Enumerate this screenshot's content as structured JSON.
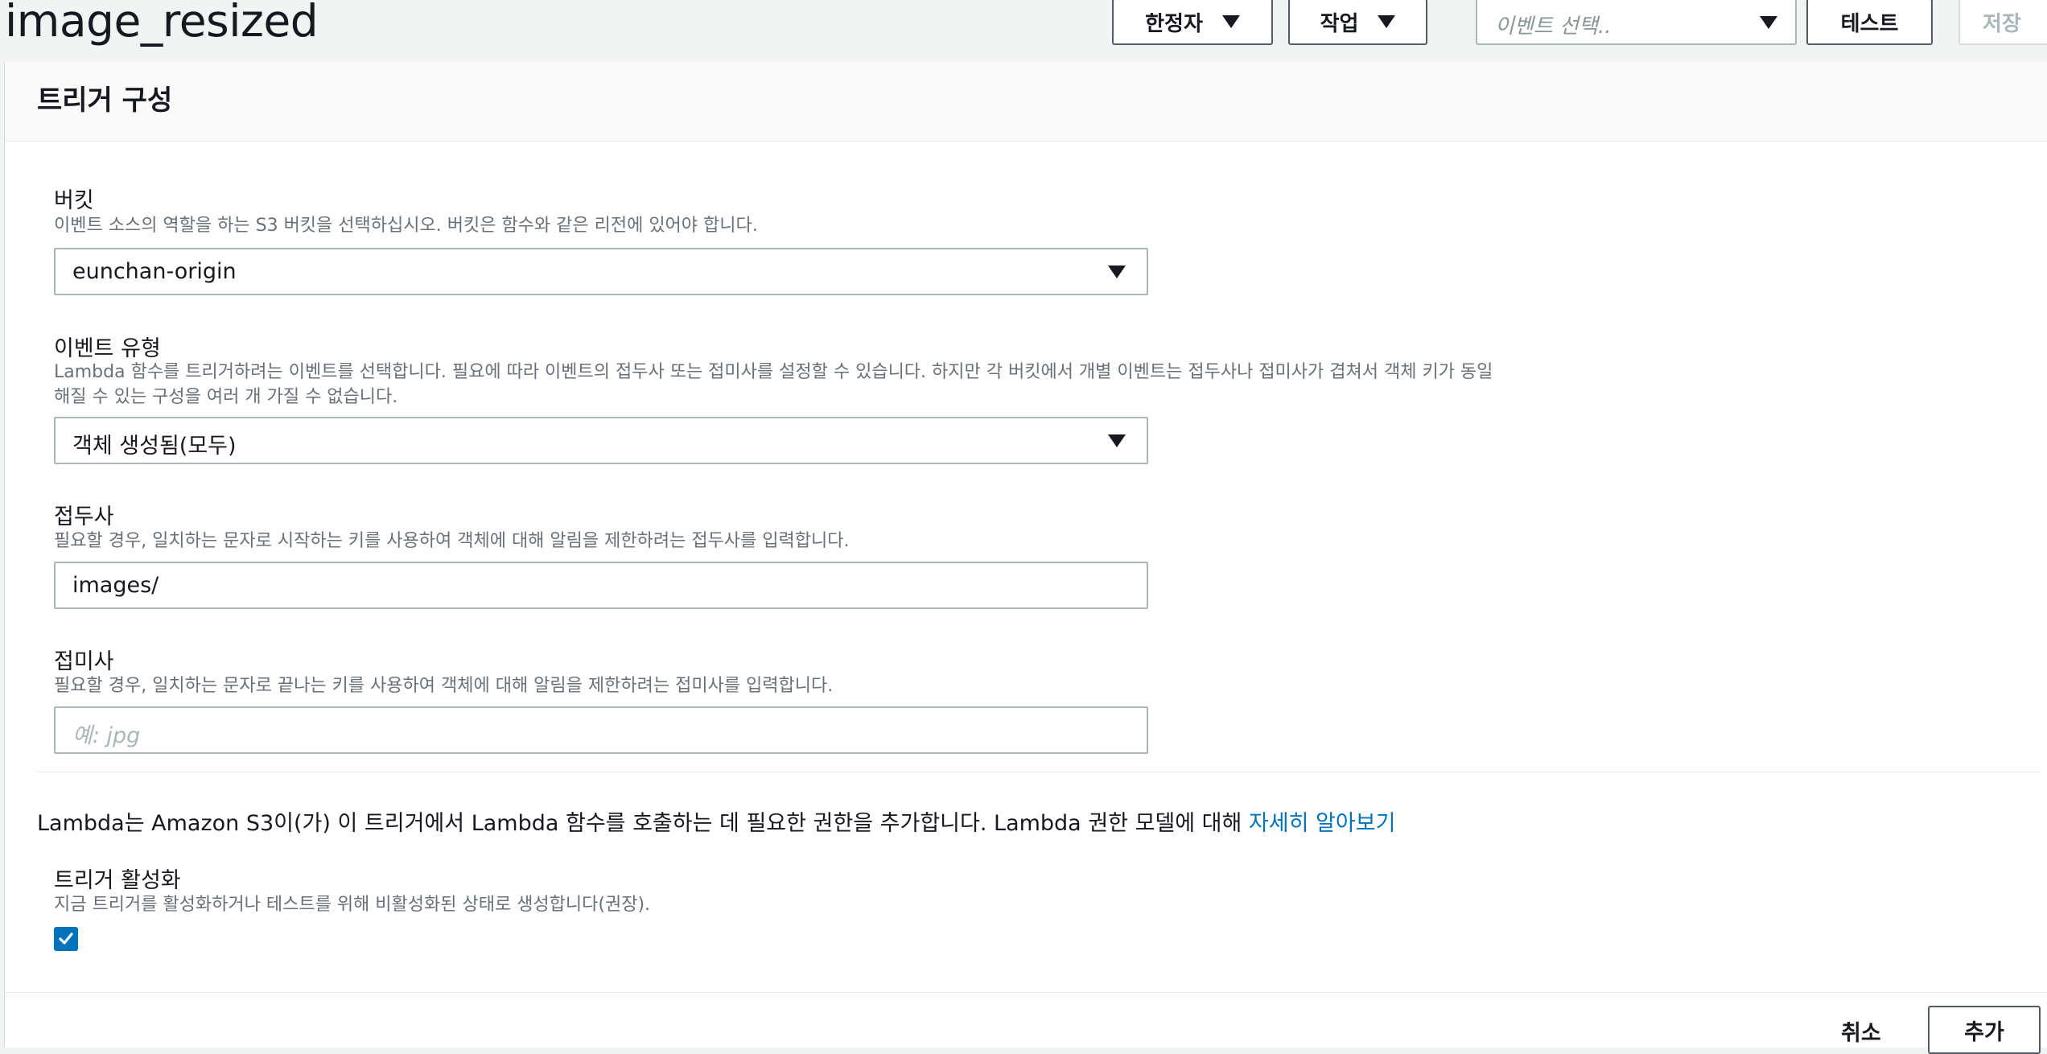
{
  "header": {
    "title": "image_resized",
    "qualifier_label": "한정자",
    "actions_label": "작업",
    "event_select_placeholder": "이벤트 선택..",
    "test_label": "테스트",
    "save_label": "저장"
  },
  "card": {
    "title": "트리거 구성",
    "bucket": {
      "label": "버킷",
      "description": "이벤트 소스의 역할을 하는 S3 버킷을 선택하십시오. 버킷은 함수와 같은 리전에 있어야 합니다.",
      "value": "eunchan-origin"
    },
    "event_type": {
      "label": "이벤트 유형",
      "description_line1": "Lambda 함수를 트리거하려는 이벤트를 선택합니다. 필요에 따라 이벤트의 접두사 또는 접미사를 설정할 수 있습니다. 하지만 각 버킷에서 개별 이벤트는 접두사나 접미사가 겹쳐서 객체 키가 동일",
      "description_line2": "해질 수 있는 구성을 여러 개 가질 수 없습니다.",
      "value": "객체 생성됨(모두)"
    },
    "prefix": {
      "label": "접두사",
      "description": "필요할 경우, 일치하는 문자로 시작하는 키를 사용하여 객체에 대해 알림을 제한하려는 접두사를 입력합니다.",
      "value": "images/"
    },
    "suffix": {
      "label": "접미사",
      "description": "필요할 경우, 일치하는 문자로 끝나는 키를 사용하여 객체에 대해 알림을 제한하려는 접미사를 입력합니다.",
      "placeholder": "예: jpg"
    },
    "permission_info": "Lambda는 Amazon S3이(가) 이 트리거에서 Lambda 함수를 호출하는 데 필요한 권한을 추가합니다. Lambda 권한 모델에 대해 ",
    "learn_more_link": "자세히 알아보기",
    "enable_trigger": {
      "label": "트리거 활성화",
      "description": "지금 트리거를 활성화하거나 테스트를 위해 비활성화된 상태로 생성합니다(권장).",
      "checked": true
    },
    "cancel_label": "취소",
    "add_label": "추가"
  },
  "colors": {
    "accent": "#0073bb",
    "link": "#0073bb",
    "border": "#aab7b8"
  }
}
